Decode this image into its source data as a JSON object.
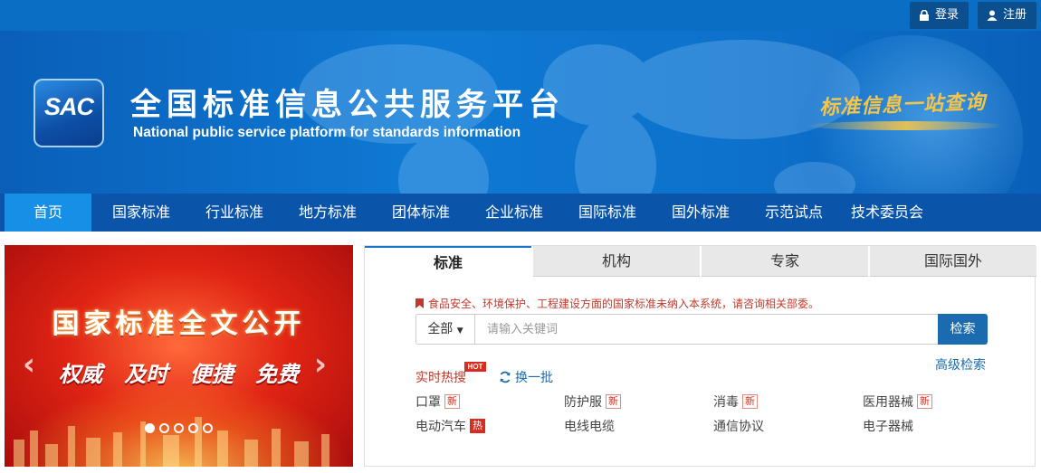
{
  "top": {
    "login": "登录",
    "register": "注册"
  },
  "header": {
    "logo": "SAC",
    "title_cn": "全国标准信息公共服务平台",
    "title_en": "National public service platform  for standards information",
    "slogan": "标准信息一站查询"
  },
  "nav": [
    "首页",
    "国家标准",
    "行业标准",
    "地方标准",
    "团体标准",
    "企业标准",
    "国际标准",
    "国外标准",
    "示范试点",
    "技术委员会"
  ],
  "carousel": {
    "title": "国家标准全文公开",
    "subtitle": "权威 及时 便捷 免费",
    "slides": 5,
    "active_slide": 1
  },
  "search": {
    "tabs": [
      "标准",
      "机构",
      "专家",
      "国际国外"
    ],
    "notice": "食品安全、环境保护、工程建设方面的国家标准未纳入本系统，请咨询相关部委。",
    "scope": "全部",
    "placeholder": "请输入关键词",
    "button": "检索",
    "advanced": "高级检索",
    "hot_label": "实时热搜",
    "hot_tag": "HOT",
    "refresh": "换一批",
    "keywords": [
      {
        "text": "口罩",
        "badge": "新",
        "badge_type": "new"
      },
      {
        "text": "防护服",
        "badge": "新",
        "badge_type": "new"
      },
      {
        "text": "消毒",
        "badge": "新",
        "badge_type": "new"
      },
      {
        "text": "医用器械",
        "badge": "新",
        "badge_type": "new"
      },
      {
        "text": "电动汽车",
        "badge": "热",
        "badge_type": "hot"
      },
      {
        "text": "电线电缆",
        "badge": "",
        "badge_type": ""
      },
      {
        "text": "通信协议",
        "badge": "",
        "badge_type": ""
      },
      {
        "text": "电子器械",
        "badge": "",
        "badge_type": ""
      }
    ]
  }
}
